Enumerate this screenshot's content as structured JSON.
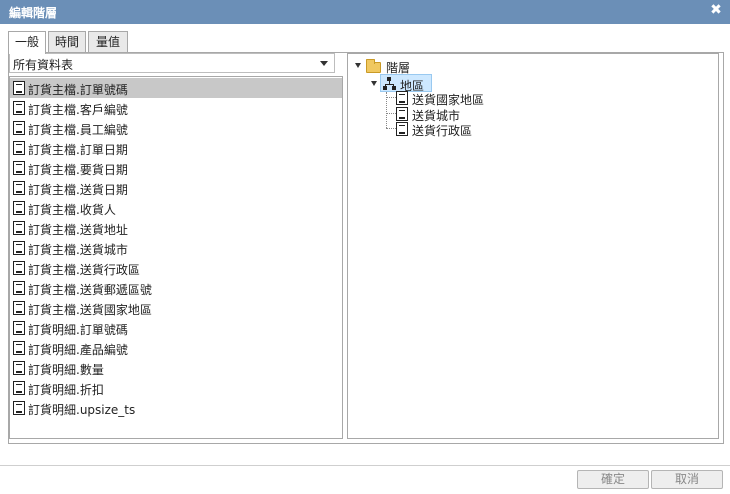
{
  "window": {
    "title": "編輯階層"
  },
  "tabs": [
    {
      "label": "一般"
    },
    {
      "label": "時間"
    },
    {
      "label": "量值"
    }
  ],
  "table_select": {
    "value": "所有資料表"
  },
  "fields": [
    "訂貨主檔.訂單號碼",
    "訂貨主檔.客戶編號",
    "訂貨主檔.員工編號",
    "訂貨主檔.訂單日期",
    "訂貨主檔.要貨日期",
    "訂貨主檔.送貨日期",
    "訂貨主檔.收貨人",
    "訂貨主檔.送貨地址",
    "訂貨主檔.送貨城市",
    "訂貨主檔.送貨行政區",
    "訂貨主檔.送貨郵遞區號",
    "訂貨主檔.送貨國家地區",
    "訂貨明細.訂單號碼",
    "訂貨明細.產品編號",
    "訂貨明細.數量",
    "訂貨明細.折扣",
    "訂貨明細.upsize_ts"
  ],
  "tree": {
    "root": "階層",
    "hierarchy": "地區",
    "levels": [
      "送貨國家地區",
      "送貨城市",
      "送貨行政區"
    ]
  },
  "buttons": {
    "ok": "確定",
    "cancel": "取消"
  }
}
